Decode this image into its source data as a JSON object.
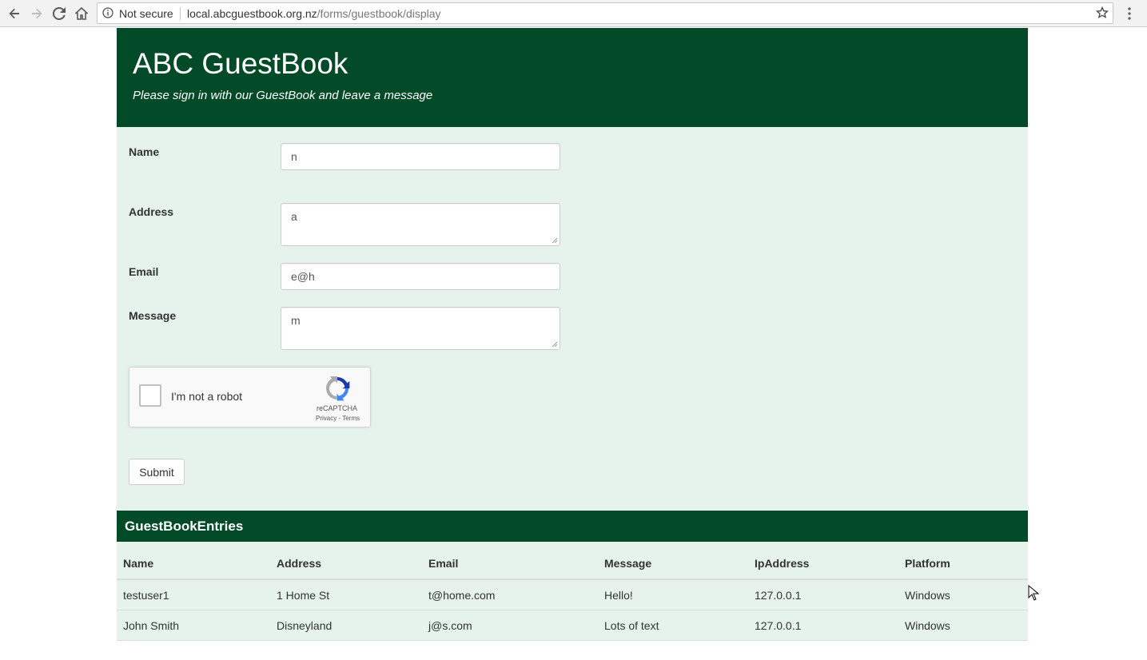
{
  "browser": {
    "security_label": "Not secure",
    "url_host": "local.abcguestbook.org.nz",
    "url_path": "/forms/guestbook/display"
  },
  "header": {
    "title": "ABC GuestBook",
    "subtitle": "Please sign in with our GuestBook and leave a message"
  },
  "form": {
    "name_label": "Name",
    "name_value": "n",
    "address_label": "Address",
    "address_value": "a",
    "email_label": "Email",
    "email_value": "e@h",
    "message_label": "Message",
    "message_value": "m",
    "captcha_text": "I'm not a robot",
    "captcha_brand": "reCAPTCHA",
    "captcha_privacy": "Privacy",
    "captcha_terms": "Terms",
    "submit_label": "Submit"
  },
  "entries": {
    "title": "GuestBookEntries",
    "columns": [
      "Name",
      "Address",
      "Email",
      "Message",
      "IpAddress",
      "Platform"
    ],
    "rows": [
      [
        "testuser1",
        "1 Home St",
        "t@home.com",
        "Hello!",
        "127.0.0.1",
        "Windows"
      ],
      [
        "John Smith",
        "Disneyland",
        "j@s.com",
        "Lots of text",
        "127.0.0.1",
        "Windows"
      ]
    ]
  },
  "colors": {
    "header_bg": "#034a28",
    "form_bg": "#e5f3ec"
  }
}
